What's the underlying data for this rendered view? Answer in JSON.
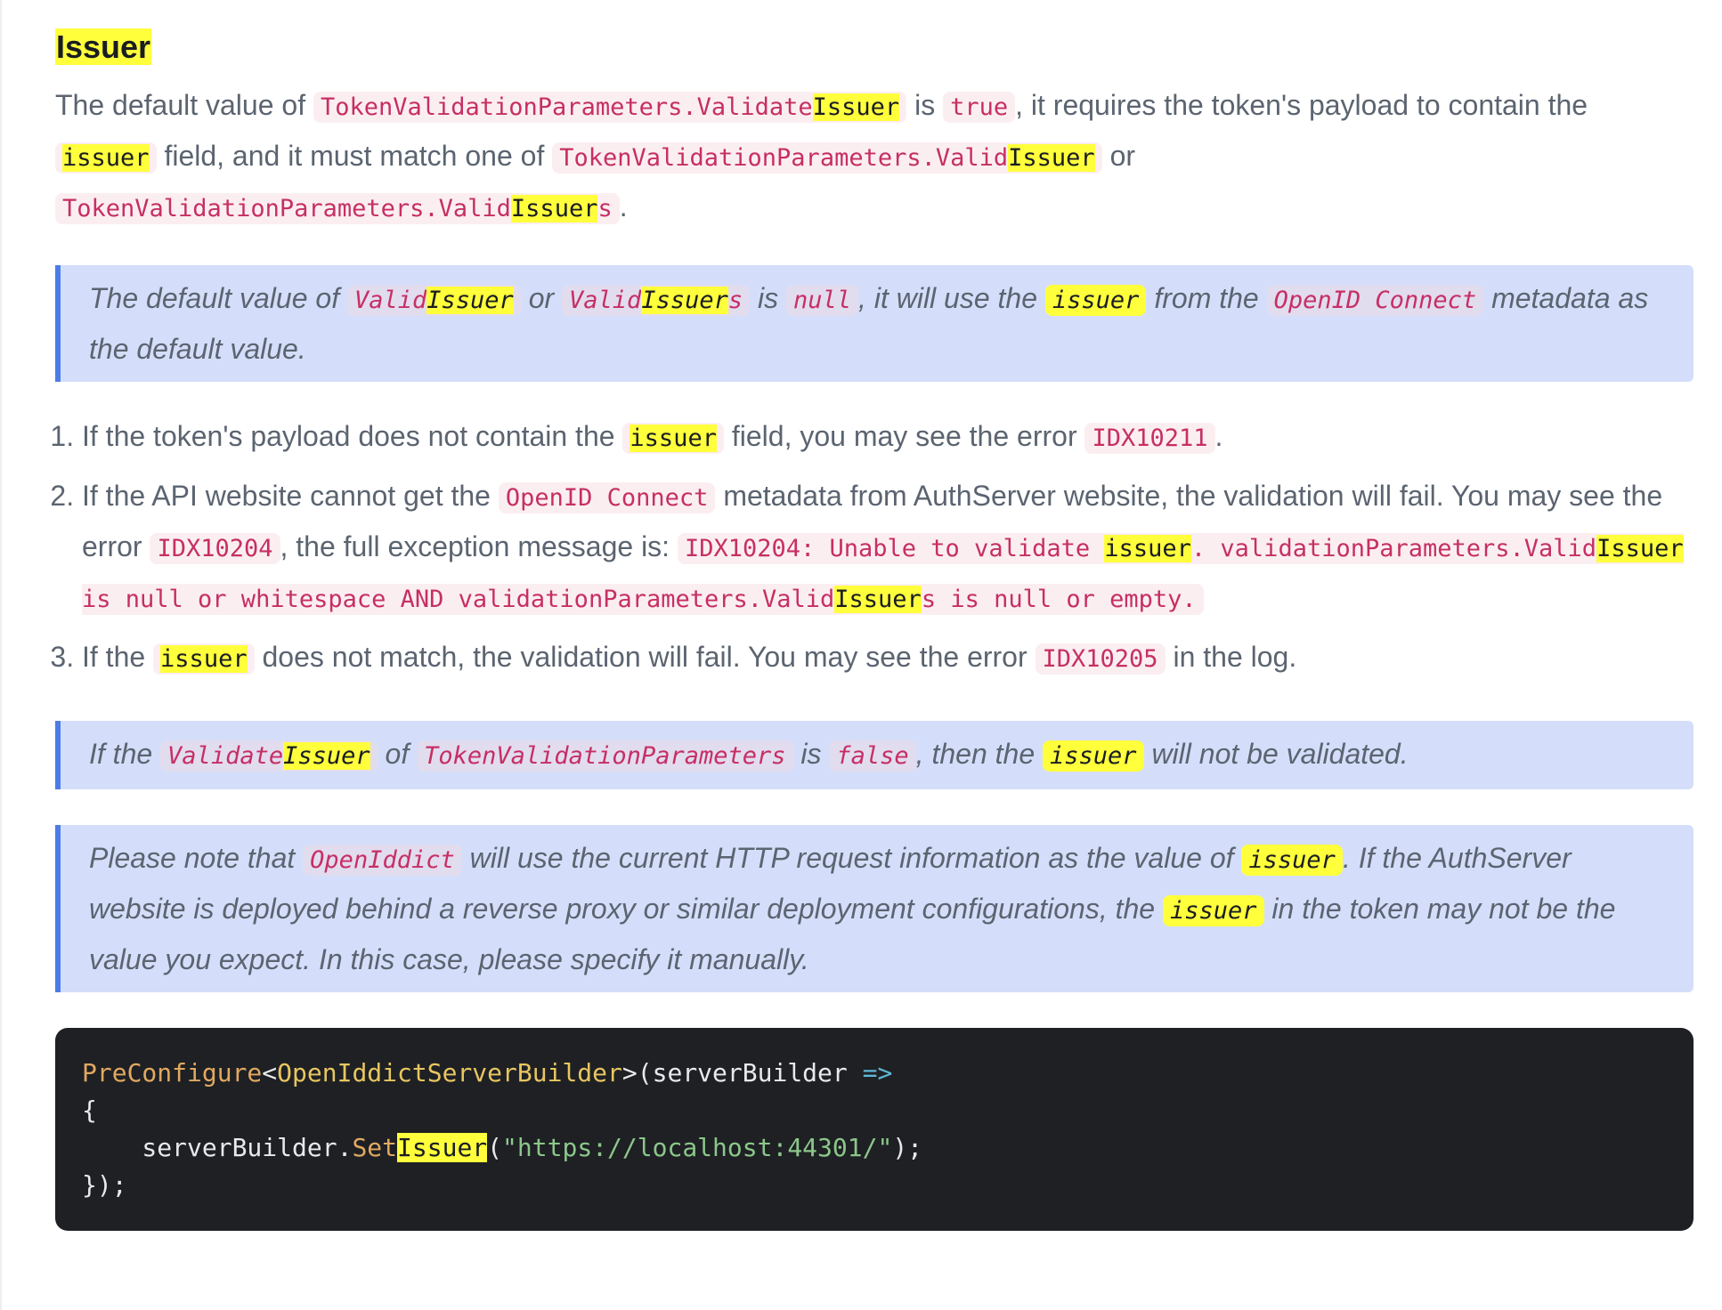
{
  "section": {
    "title": "Issuer"
  },
  "intro": {
    "t1": "The default value of ",
    "c1a": "TokenValidationParameters.Validate",
    "c1b": "Issuer",
    "t2": " is ",
    "c2": "true",
    "t3": ", it requires the token's payload to contain the ",
    "c3": "issuer",
    "t4": " field, and it must match one of ",
    "c4a": "TokenValidationParameters.Valid",
    "c4b": "Issuer",
    "t5": " or ",
    "c5a": "TokenValidationParameters.Valid",
    "c5b": "Issuer",
    "c5c": "s",
    "t6": "."
  },
  "callout1": {
    "t1": "The default value of ",
    "c1a": "Valid",
    "c1b": "Issuer",
    "t2": " or ",
    "c2a": "Valid",
    "c2b": "Issuer",
    "c2c": "s",
    "t3": " is ",
    "c3": "null",
    "t4": ", it will use the ",
    "c4": "issuer",
    "t5": " from the ",
    "c5": "OpenID Connect",
    "t6": " metadata as the default value."
  },
  "steps": [
    {
      "t1": "If the token's payload does not contain the ",
      "c1": "issuer",
      "t2": " field, you may see the error ",
      "c2": "IDX10211",
      "t3": "."
    },
    {
      "t1": "If the API website cannot get the ",
      "c1": "OpenID Connect",
      "t2": " metadata from AuthServer website, the validation will fail. You may see the error ",
      "c2": "IDX10204",
      "t3": ", the full exception message is: ",
      "c3a": "IDX10204: Unable to validate ",
      "c3b": "issuer",
      "c3c": ". validationParameters.Valid",
      "c3d": "Issuer",
      "c3e": " is null or whitespace AND validationParameters.Valid",
      "c3f": "Issuer",
      "c3g": "s is null or empty."
    },
    {
      "t1": "If the ",
      "c1": "issuer",
      "t2": " does not match, the validation will fail. You may see the error ",
      "c2": "IDX10205",
      "t3": " in the log."
    }
  ],
  "callout2": {
    "t1": "If the ",
    "c1a": "Validate",
    "c1b": "Issuer",
    "t2": " of ",
    "c2": "TokenValidationParameters",
    "t3": " is ",
    "c3": "false",
    "t4": ", then the ",
    "c4": "issuer",
    "t5": " will not be validated."
  },
  "callout3": {
    "t1": "Please note that ",
    "c1": "OpenIddict",
    "t2": " will use the current HTTP request information as the value of ",
    "c2": "issuer",
    "t3": ". If the AuthServer website is deployed behind a reverse proxy or similar deployment configurations, the ",
    "c3": "issuer",
    "t4": " in the token may not be the value you expect. In this case, please specify it manually."
  },
  "code": {
    "l1_method": "PreConfigure",
    "l1_lt": "<",
    "l1_type": "OpenIddictServerBuilder",
    "l1_gt": ">",
    "l1_rest": "(serverBuilder ",
    "l1_arrow": "=>",
    "l2": "{",
    "l3_indent": "    serverBuilder.",
    "l3_set": "Set",
    "l3_issuer": "Issuer",
    "l3_open": "(",
    "l3_string": "\"https://localhost:44301/\"",
    "l3_close": ");",
    "l4": "});"
  }
}
